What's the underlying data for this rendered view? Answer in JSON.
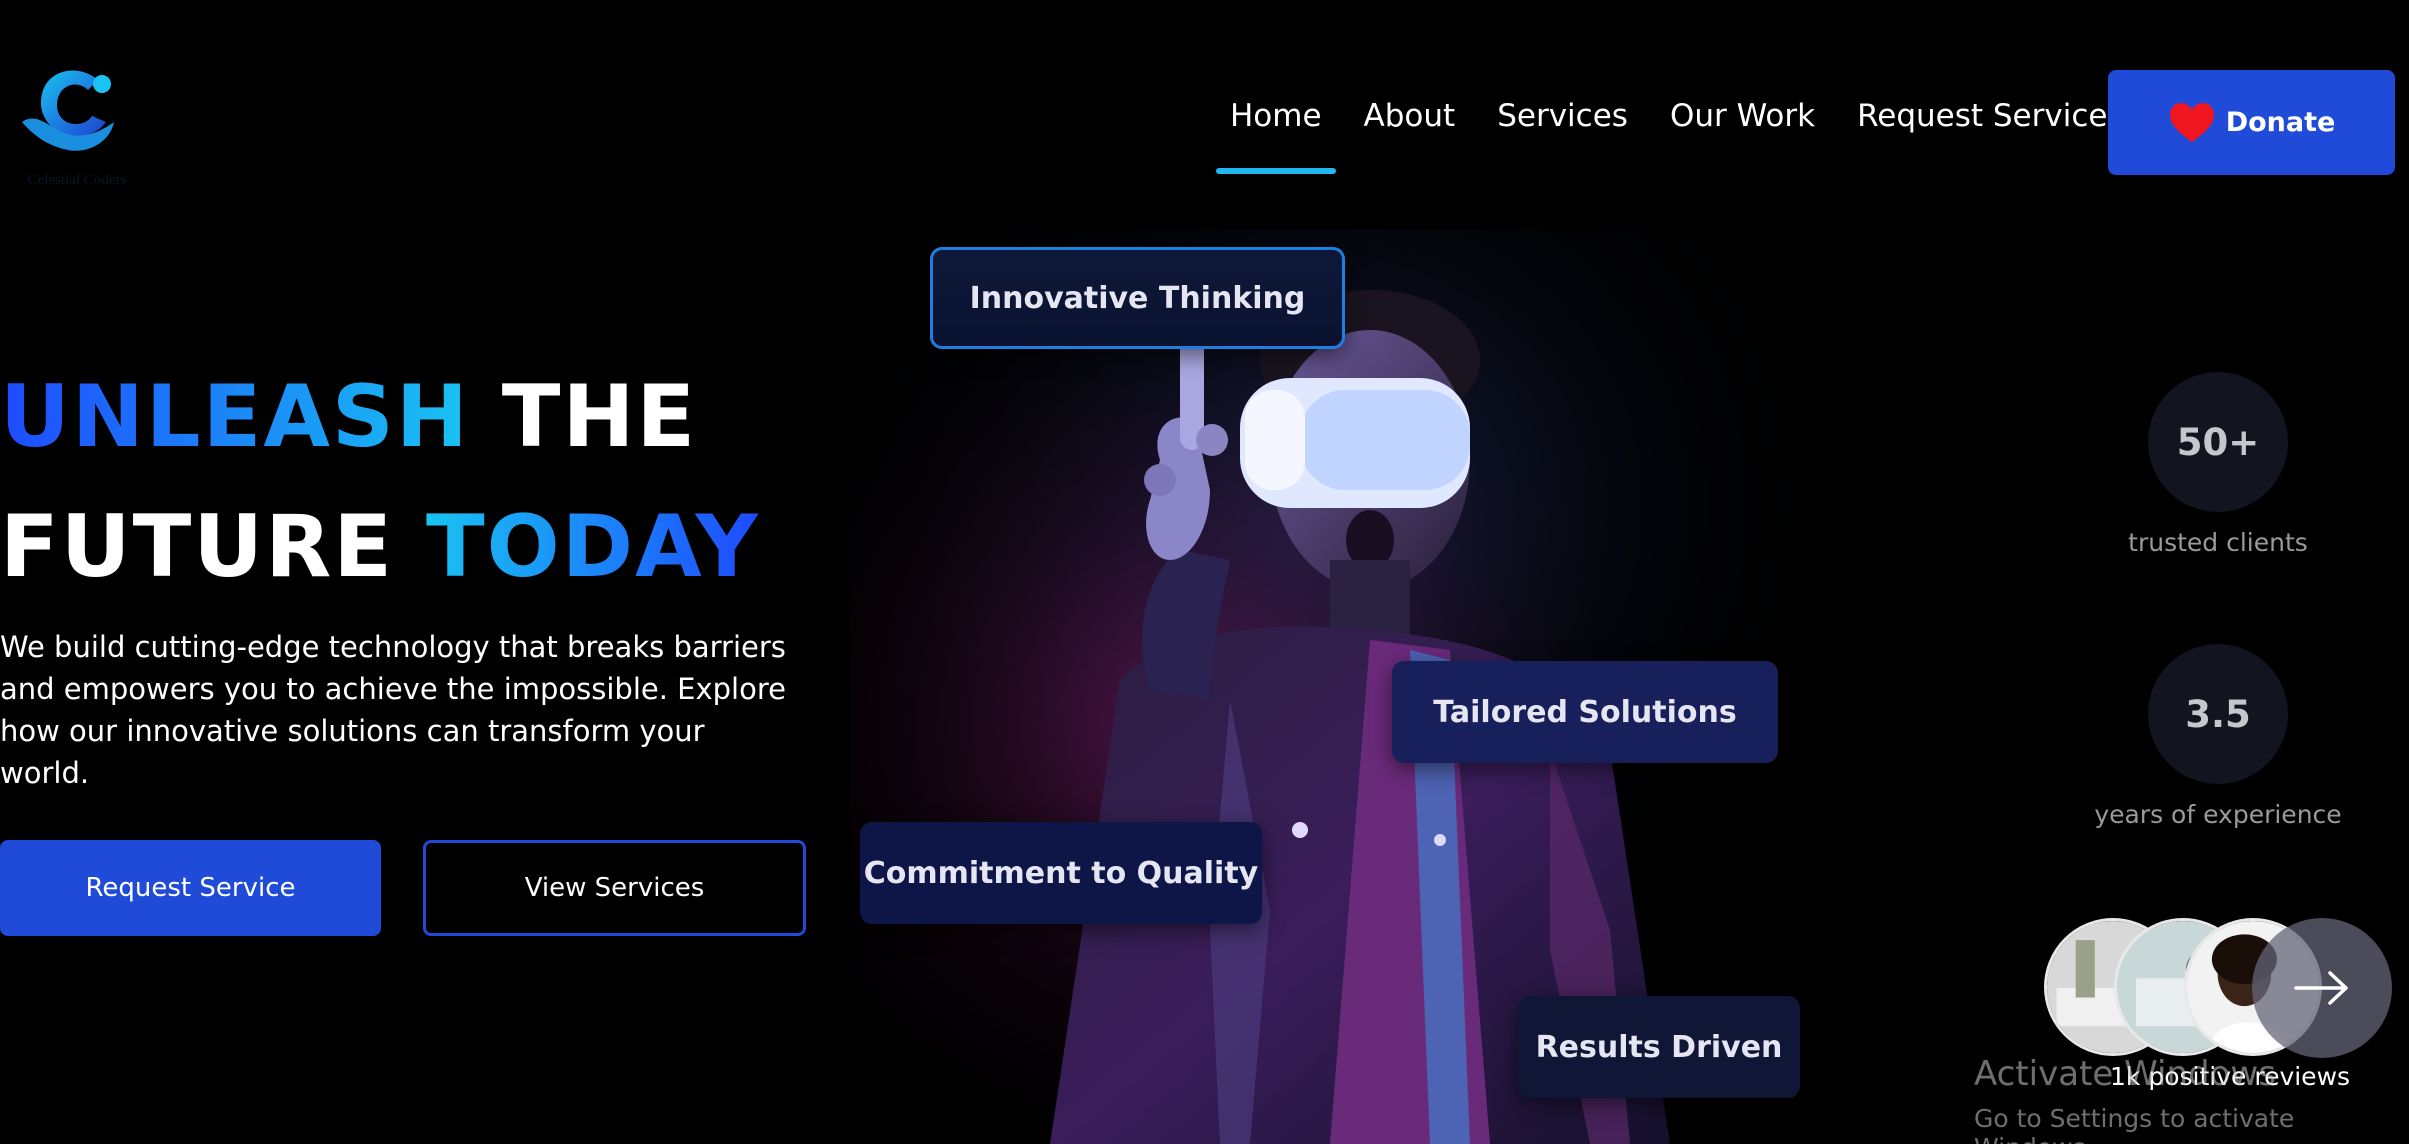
{
  "header": {
    "logo_text": "Celestial Coders",
    "nav": [
      {
        "label": "Home",
        "active": true
      },
      {
        "label": "About",
        "active": false
      },
      {
        "label": "Services",
        "active": false
      },
      {
        "label": "Our Work",
        "active": false
      },
      {
        "label": "Request Services",
        "active": false
      }
    ],
    "donate_label": "Donate",
    "donate_icon": "heart-icon"
  },
  "hero": {
    "headline": {
      "word1": "UNLEASH",
      "word2": "THE",
      "word3": "FUTURE",
      "word4": "TODAY"
    },
    "intro": "We build cutting-edge technology that breaks barriers and empowers you to achieve the impossible. Explore how our innovative solutions can transform your world.",
    "primary_button": "Request Service",
    "secondary_button": "View Services"
  },
  "tags": [
    "Innovative Thinking",
    "Tailored Solutions",
    "Commitment to Quality",
    "Results Driven"
  ],
  "stats": [
    {
      "value": "50+",
      "label": "trusted clients"
    },
    {
      "value": "3.5",
      "label": "years of experience"
    }
  ],
  "reviews": {
    "label": "1k positive reviews",
    "arrow_icon": "arrow-right-icon"
  },
  "watermark": {
    "title": "Activate Windows",
    "subtitle": "Go to Settings to activate Windows."
  },
  "colors": {
    "accent_blue": "#1f4bd8",
    "accent_cyan": "#1fb8f0",
    "background": "#000000"
  }
}
